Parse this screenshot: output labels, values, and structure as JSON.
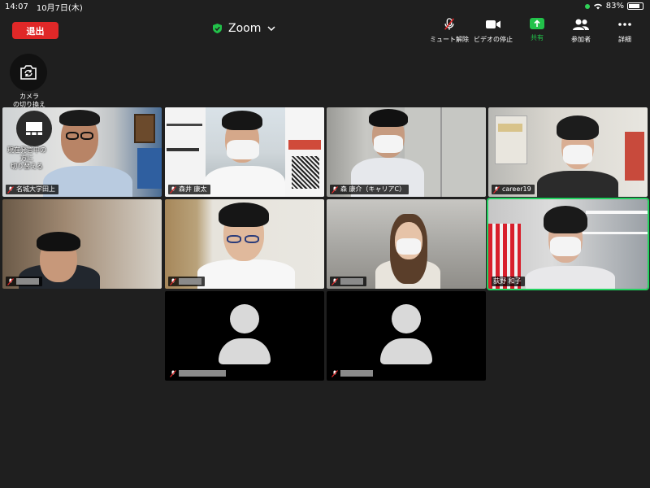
{
  "status": {
    "time": "14:07",
    "date": "10月7日(木)",
    "battery": "83%",
    "battery_level": 0.83
  },
  "meeting": {
    "leave_label": "退出",
    "title": "Zoom"
  },
  "toolbar": {
    "mute_label": "ミュート解除",
    "video_label": "ビデオの停止",
    "share_label": "共有",
    "participants_label": "参加者",
    "more_label": "詳細"
  },
  "side": {
    "camera_switch_label": "カメラ\nの切り換え",
    "speaker_switch_label": "現在発言中の\n方に\n切り替える"
  },
  "colors": {
    "accent_green": "#22c24a",
    "leave_red": "#e02828",
    "active_border": "#23d160"
  },
  "tiles": [
    {
      "name": "名城大学田上",
      "muted": true,
      "video": true
    },
    {
      "name": "森井 康太",
      "muted": true,
      "video": true
    },
    {
      "name": "森 康介（キャリアC）",
      "muted": true,
      "video": true
    },
    {
      "name": "career19",
      "muted": true,
      "video": true
    },
    {
      "name": "",
      "muted": true,
      "video": true,
      "name_hidden": true
    },
    {
      "name": "",
      "muted": true,
      "video": true,
      "name_hidden": true
    },
    {
      "name": "",
      "muted": true,
      "video": true,
      "name_hidden": true
    },
    {
      "name": "荻野 和子",
      "muted": true,
      "video": true,
      "active_speaker": true
    },
    {
      "name": "",
      "muted": true,
      "video": false,
      "name_hidden": true
    },
    {
      "name": "",
      "muted": true,
      "video": false,
      "name_hidden": true
    }
  ]
}
